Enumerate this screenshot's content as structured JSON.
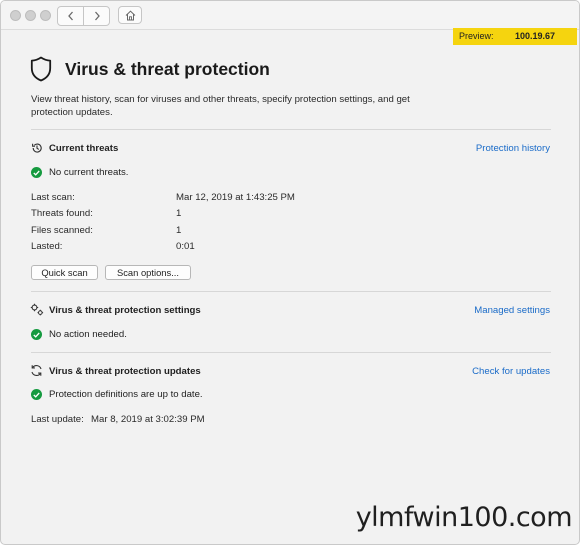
{
  "preview": {
    "label": "Preview:",
    "version": "100.19.67"
  },
  "page": {
    "title": "Virus & threat protection",
    "description": "View threat history, scan for viruses and other threats, specify protection settings, and get protection updates."
  },
  "current_threats": {
    "title": "Current threats",
    "link": "Protection history",
    "status": "No current threats.",
    "rows": [
      {
        "label": "Last scan:",
        "value": "Mar 12, 2019 at 1:43:25 PM"
      },
      {
        "label": "Threats found:",
        "value": "1"
      },
      {
        "label": "Files scanned:",
        "value": "1"
      },
      {
        "label": "Lasted:",
        "value": "0:01"
      }
    ],
    "quick_scan": "Quick scan",
    "scan_options": "Scan options..."
  },
  "settings": {
    "title": "Virus & threat protection settings",
    "link": "Managed settings",
    "status": "No action needed."
  },
  "updates": {
    "title": "Virus & threat protection updates",
    "link": "Check for updates",
    "status": "Protection definitions are up to date.",
    "last_update_label": "Last update:",
    "last_update_value": "Mar 8, 2019 at 3:02:39 PM"
  },
  "watermark": "ylmfwin100.com",
  "colors": {
    "accent_link": "#1a6bc8",
    "status_ok": "#159a3f",
    "preview_banner": "#f5d40f"
  },
  "icons": [
    "shield-icon",
    "history-icon",
    "gear-icon",
    "refresh-icon",
    "check-circle-icon",
    "home-icon",
    "back-icon",
    "forward-icon"
  ]
}
